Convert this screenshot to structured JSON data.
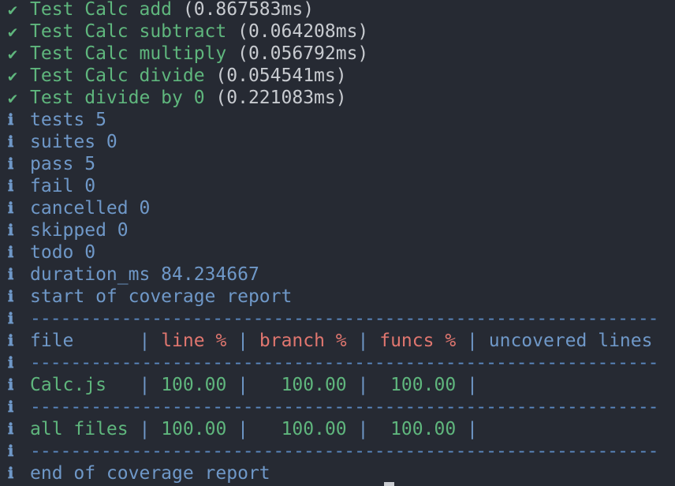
{
  "icons": {
    "pass": "check-mark-icon",
    "info": "info-icon"
  },
  "colors": {
    "background": "#262a33",
    "pass_green": "#5fb67d",
    "info_blue": "#6f98c8",
    "header_red": "#e0766f",
    "duration_gray": "#c8cbd0"
  },
  "marks": {
    "pass": "✔",
    "info": "ℹ"
  },
  "tests": [
    {
      "name": "Test Calc add",
      "duration": "(0.867583ms)"
    },
    {
      "name": "Test Calc subtract",
      "duration": "(0.064208ms)"
    },
    {
      "name": "Test Calc multiply",
      "duration": "(0.056792ms)"
    },
    {
      "name": "Test Calc divide",
      "duration": "(0.054541ms)"
    },
    {
      "name": "Test divide by 0",
      "duration": "(0.221083ms)"
    }
  ],
  "summary": [
    "tests 5",
    "suites 0",
    "pass 5",
    "fail 0",
    "cancelled 0",
    "skipped 0",
    "todo 0",
    "duration_ms 84.234667"
  ],
  "coverage": {
    "start": "start of coverage report",
    "end": "end of coverage report",
    "separator": "--------------------------------------------------------------",
    "header": {
      "file": "file      ",
      "line": "line %",
      "branch": "branch %",
      "funcs": "funcs %",
      "uncovered": "uncovered lines"
    },
    "rows": [
      {
        "file": "Calc.js   ",
        "line": "100.00",
        "branch": "  100.00",
        "funcs": " 100.00"
      },
      {
        "file": "all files ",
        "line": "100.00",
        "branch": "  100.00",
        "funcs": " 100.00"
      }
    ],
    "pipe": "|"
  }
}
